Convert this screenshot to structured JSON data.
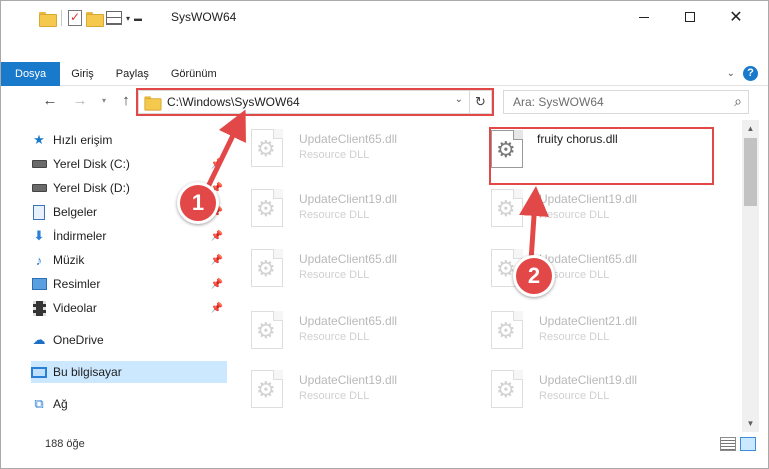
{
  "window": {
    "title": "SysWOW64",
    "controls": {
      "minimize": "minimize",
      "maximize": "maximize",
      "close": "close"
    }
  },
  "ribbon": {
    "tabs": [
      "Dosya",
      "Giriş",
      "Paylaş",
      "Görünüm"
    ],
    "help": "?"
  },
  "navigation": {
    "address_path": "C:\\Windows\\SysWOW64",
    "search_placeholder": "Ara: SysWOW64"
  },
  "sidebar": {
    "items": [
      {
        "label": "Hızlı erişim",
        "icon": "star-icon",
        "pinned": false
      },
      {
        "label": "Yerel Disk (C:)",
        "icon": "drive-icon",
        "pinned": true
      },
      {
        "label": "Yerel Disk (D:)",
        "icon": "drive-icon",
        "pinned": true
      },
      {
        "label": "Belgeler",
        "icon": "documents-icon",
        "pinned": true
      },
      {
        "label": "İndirmeler",
        "icon": "downloads-icon",
        "pinned": true
      },
      {
        "label": "Müzik",
        "icon": "music-icon",
        "pinned": true
      },
      {
        "label": "Resimler",
        "icon": "pictures-icon",
        "pinned": true
      },
      {
        "label": "Videolar",
        "icon": "videos-icon",
        "pinned": true
      },
      {
        "label": "OneDrive",
        "icon": "onedrive-icon",
        "pinned": false
      },
      {
        "label": "Bu bilgisayar",
        "icon": "this-pc-icon",
        "pinned": false,
        "selected": true
      },
      {
        "label": "Ağ",
        "icon": "network-icon",
        "pinned": false
      }
    ]
  },
  "files": {
    "highlighted": {
      "name": "fruity chorus.dll"
    },
    "left_column": [
      {
        "name": "UpdateClient65.dll",
        "type": "Resource DLL"
      },
      {
        "name": "UpdateClient19.dll",
        "type": "Resource DLL"
      },
      {
        "name": "UpdateClient65.dll",
        "type": "Resource DLL"
      },
      {
        "name": "UpdateClient65.dll",
        "type": "Resource DLL"
      },
      {
        "name": "UpdateClient19.dll",
        "type": "Resource DLL"
      }
    ],
    "right_column": [
      {
        "name": "UpdateClient19.dll",
        "type": "Resource DLL"
      },
      {
        "name": "UpdateClient65.dll",
        "type": "Resource DLL"
      },
      {
        "name": "UpdateClient21.dll",
        "type": "Resource DLL"
      },
      {
        "name": "UpdateClient19.dll",
        "type": "Resource DLL"
      }
    ]
  },
  "status": {
    "item_count": "188 öğe"
  },
  "callouts": [
    {
      "number": "1",
      "target": "address bar"
    },
    {
      "number": "2",
      "target": "fruity chorus.dll"
    }
  ],
  "colors": {
    "accent": "#1979ca",
    "callout": "#e34848",
    "selected": "#cce8ff"
  }
}
